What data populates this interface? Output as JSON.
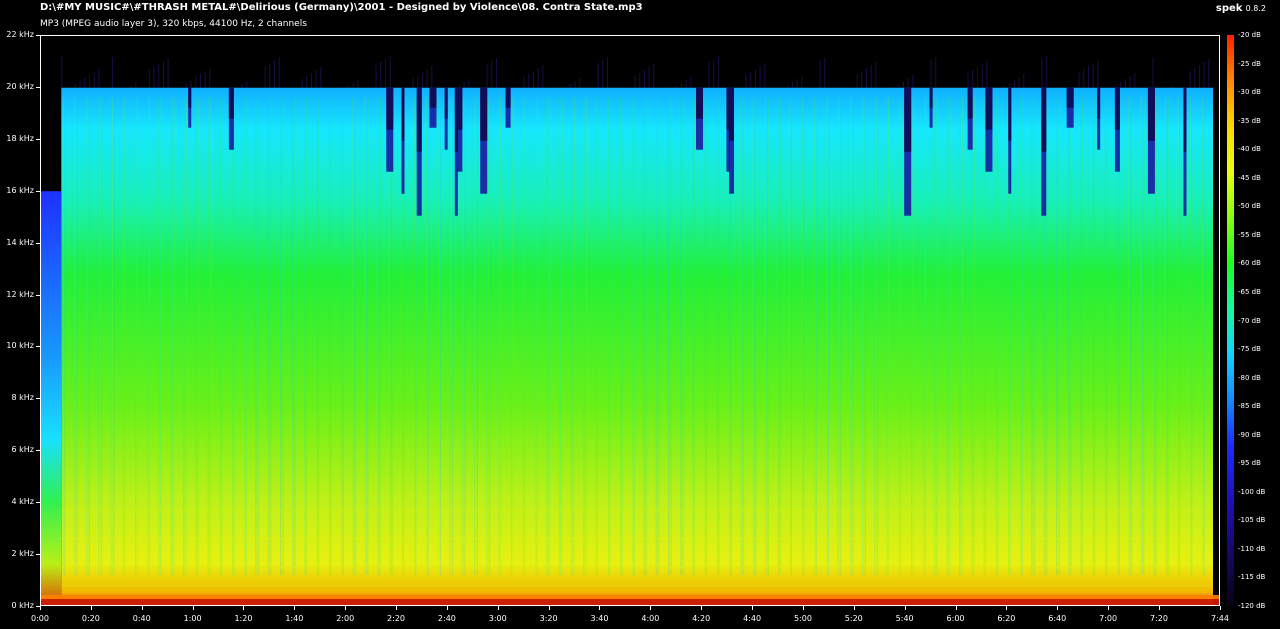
{
  "window": {
    "file_path": "D:\\#MY MUSIC#\\#THRASH METAL#\\Delirious (Germany)\\2001 - Designed by Violence\\08. Contra State.mp3",
    "file_info": "MP3 (MPEG audio layer 3), 320 kbps, 44100 Hz, 2 channels",
    "brand_name": "spek",
    "brand_version": "0.8.2"
  },
  "chart_data": {
    "type": "heatmap",
    "y_axis": {
      "unit": "kHz",
      "range": [
        0,
        22
      ],
      "tick_labels": [
        "22 kHz",
        "20 kHz",
        "18 kHz",
        "16 kHz",
        "14 kHz",
        "12 kHz",
        "10 kHz",
        "8 kHz",
        "6 kHz",
        "4 kHz",
        "2 kHz",
        "0 kHz"
      ]
    },
    "x_axis": {
      "unit": "time",
      "range_seconds": [
        0,
        464
      ],
      "tick_labels": [
        "0:00",
        "0:20",
        "0:40",
        "1:00",
        "1:20",
        "1:40",
        "2:00",
        "2:20",
        "2:40",
        "3:00",
        "3:20",
        "3:40",
        "4:00",
        "4:20",
        "4:40",
        "5:00",
        "5:20",
        "5:40",
        "6:00",
        "6:20",
        "6:40",
        "7:00",
        "7:20",
        "7:44"
      ]
    },
    "colorbar": {
      "unit": "dB",
      "range": [
        -120,
        -20
      ],
      "tick_labels": [
        "-20 dB",
        "-25 dB",
        "-30 dB",
        "-35 dB",
        "-40 dB",
        "-45 dB",
        "-50 dB",
        "-55 dB",
        "-60 dB",
        "-65 dB",
        "-70 dB",
        "-75 dB",
        "-80 dB",
        "-85 dB",
        "-90 dB",
        "-95 dB",
        "-100 dB",
        "-105 dB",
        "-110 dB",
        "-115 dB",
        "-120 dB"
      ]
    },
    "cutoff_khz": 20,
    "intro_cutoff_khz": 16,
    "intro_end_seconds": 8,
    "drop_times_seconds": [
      58,
      74,
      136,
      142,
      148,
      153,
      159,
      164,
      173,
      163,
      183,
      258,
      270,
      271,
      340,
      350,
      365,
      372,
      381,
      394,
      404,
      416,
      423,
      436,
      450
    ]
  },
  "colors": {
    "background": "#000000",
    "text": "#ffffff"
  }
}
